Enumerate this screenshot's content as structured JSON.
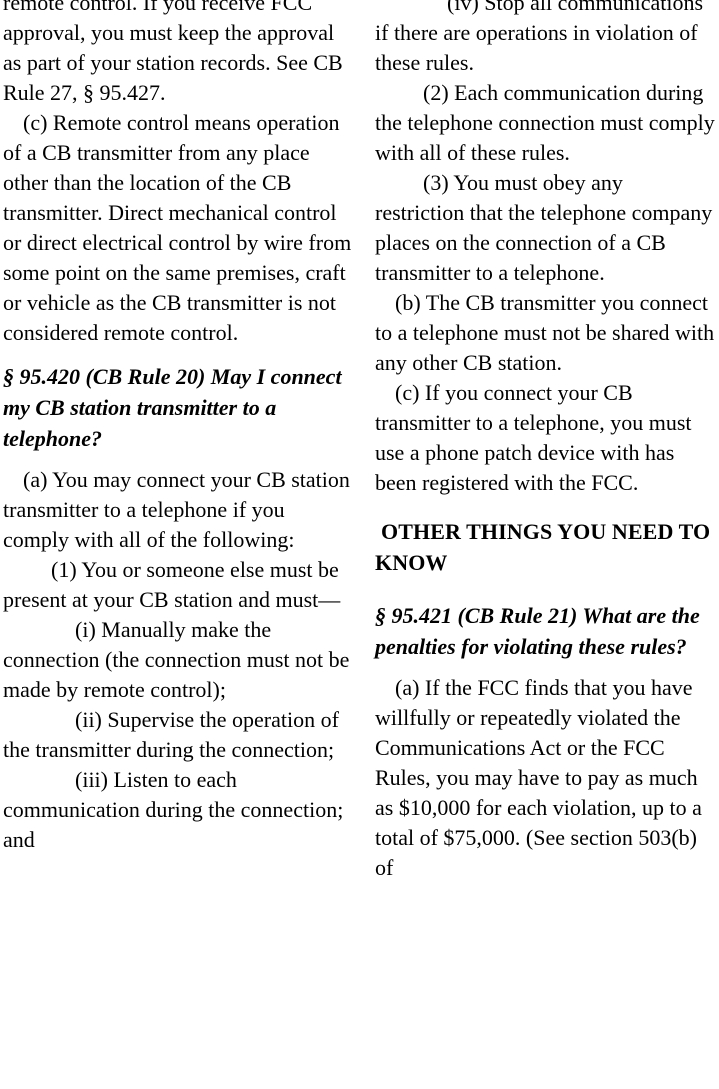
{
  "document": {
    "kind": "scanned-legal-rules-page",
    "columns": 2
  },
  "left_column": {
    "blocks": [
      {
        "id": "b-remote-control-approval",
        "indent": "lvl-0",
        "text": "remote control. If you receive FCC approval, you must keep the approval as part of your station records. See CB Rule 27, § 95.427."
      },
      {
        "id": "b-c-remote-control-means",
        "indent": "lvl-a",
        "text": "(c) Remote control means operation of a CB transmitter from any place other than the location of the CB transmitter. Direct mechanical control or direct electrical control by wire from some point on the same premises, craft or vehicle as the CB transmitter is not considered remote control."
      },
      {
        "id": "h-95-420",
        "type": "section-heading",
        "text": "§ 95.420 (CB Rule 20) May I connect my CB station transmitter to a telephone?"
      },
      {
        "id": "b-a-you-may-connect",
        "indent": "lvl-a",
        "text": "(a) You may connect your CB station transmitter to a telephone if you comply with all of the following:"
      },
      {
        "id": "b-1-you-or-someone-else",
        "indent": "lvl-1",
        "text": "(1) You or someone else must be present at your CB station and must—"
      },
      {
        "id": "b-i-manually-make",
        "indent": "lvl-i",
        "text": "(i) Manually make the connection (the connection must not be made by remote control);"
      },
      {
        "id": "b-ii-supervise",
        "indent": "lvl-i",
        "text": "(ii) Supervise the operation of the transmitter during the connection;"
      },
      {
        "id": "b-iii-listen",
        "indent": "lvl-i",
        "text": "(iii) Listen to each communication during the connection; and"
      }
    ]
  },
  "right_column": {
    "blocks": [
      {
        "id": "b-iv-stop-all",
        "indent": "lvl-i",
        "text": "(iv) Stop all communications if there are operations in violation of these rules."
      },
      {
        "id": "b-2-each-communication",
        "indent": "lvl-1",
        "text": "(2) Each communication during the telephone connection must comply with all of these rules."
      },
      {
        "id": "b-3-obey-restriction",
        "indent": "lvl-1",
        "text": "(3) You must obey any restriction that the telephone company places on the connection of a CB transmitter to a telephone."
      },
      {
        "id": "b-b-not-shared",
        "indent": "lvl-a",
        "text": "(b) The CB transmitter you connect to a telephone must not be shared with any other CB station."
      },
      {
        "id": "b-c-phone-patch",
        "indent": "lvl-a",
        "text": "(c) If you connect your CB transmitter to a telephone, you must use a phone patch device with has been registered with the FCC."
      },
      {
        "id": "h-other-things",
        "type": "major-heading",
        "text": "OTHER THINGS YOU NEED TO KNOW"
      },
      {
        "id": "h-95-421",
        "type": "section-heading",
        "text": "§ 95.421 (CB Rule 21) What are the penalties for violating these rules?"
      },
      {
        "id": "b-a-penalties",
        "indent": "lvl-a",
        "text": "(a) If the FCC finds that you have willfully or repeatedly violated the Communications Act or the FCC Rules, you may have to pay as much as $10,000 for each violation, up to a total of $75,000. (See section 503(b) of"
      }
    ]
  }
}
